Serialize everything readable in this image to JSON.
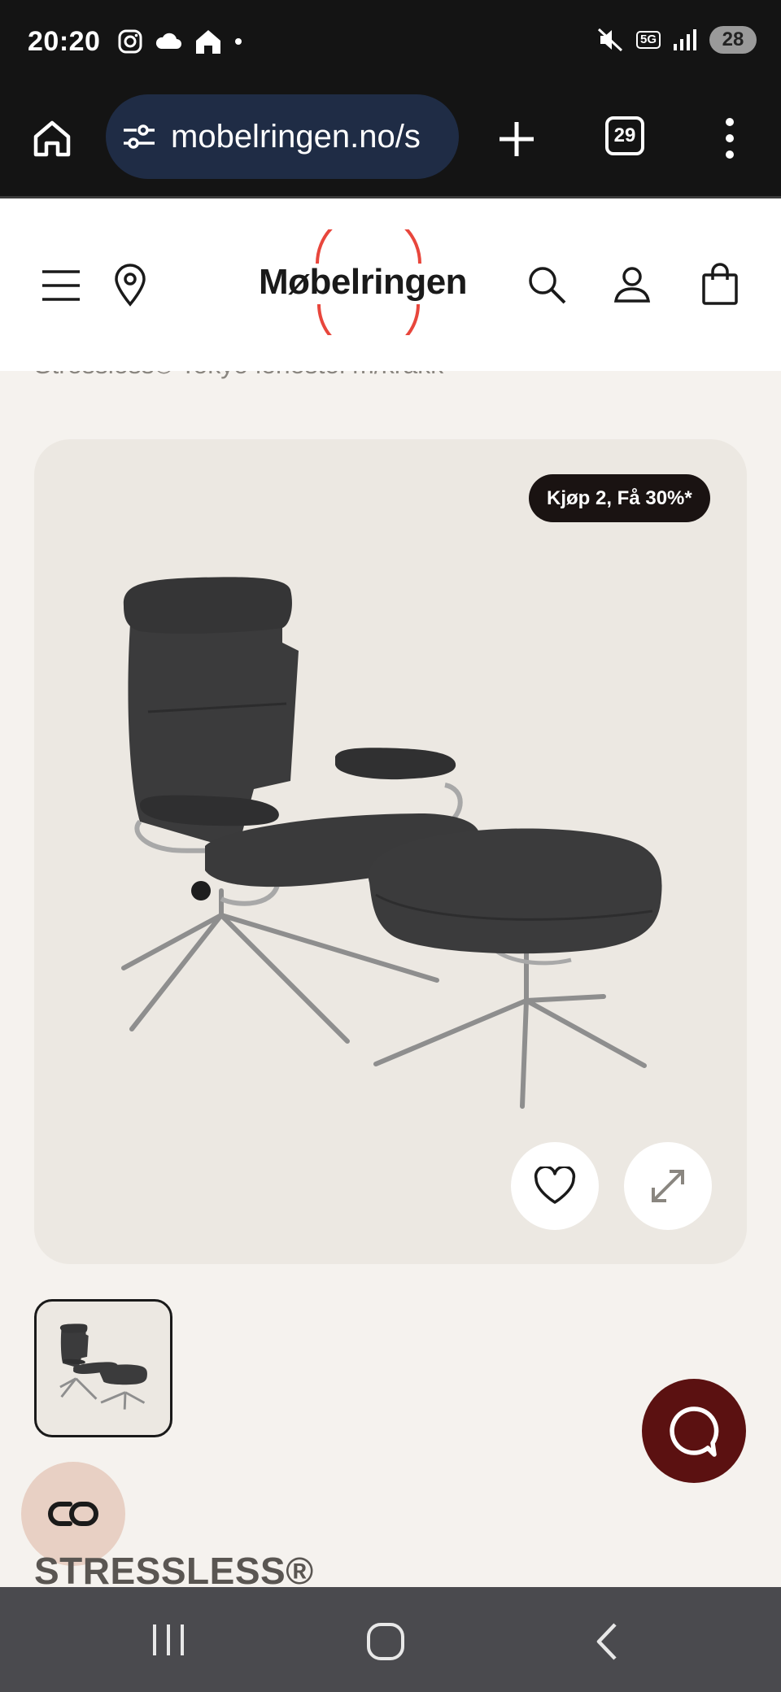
{
  "status_bar": {
    "time": "20:20",
    "battery": "28",
    "network": "5G"
  },
  "browser": {
    "url": "mobelringen.no/s",
    "tabs_count": "29"
  },
  "site": {
    "logo": "Møbelringen",
    "brand_color": "#e8463c"
  },
  "breadcrumb": "Stressless® Tokyo lenestol m/krakk",
  "product": {
    "promo_badge": "Kjøp 2, Få 30%*",
    "brand": "STRESSLESS®",
    "chair_color": "#3a3a3a"
  },
  "icons": {
    "home": "home-icon",
    "site_settings": "tune-icon",
    "new_tab": "plus-icon",
    "menu": "more-vert-icon",
    "hamburger": "hamburger-icon",
    "location": "location-pin-icon",
    "search": "search-icon",
    "account": "user-icon",
    "cart": "shopping-bag-icon",
    "favorite": "heart-icon",
    "expand": "expand-icon",
    "chat": "chat-icon",
    "co": "co-icon"
  }
}
